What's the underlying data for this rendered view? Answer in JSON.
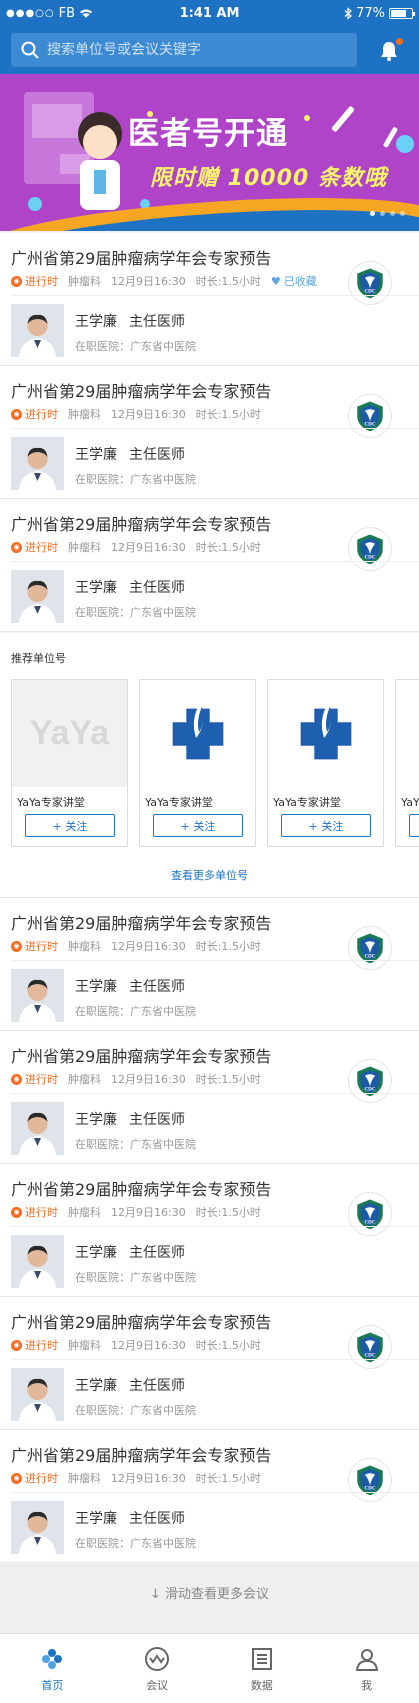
{
  "status_bar": {
    "carrier": "FB",
    "time": "1:41 AM",
    "battery": "77%",
    "battery_level": 0.77
  },
  "search": {
    "placeholder": "搜索单位号或会议关键字"
  },
  "banner": {
    "title": "医者号开通",
    "subtitle": "限时赠 10000 条数哦",
    "pages": 4,
    "active_page": 0
  },
  "meetings": [
    {
      "title": "广州省第29届肿瘤病学年会专家预告",
      "status": "进行时",
      "department": "肿瘤科",
      "time": "12月9日16:30",
      "duration": "时长:1.5小时",
      "favorite": "已收藏",
      "doctor_name": "王学廉",
      "doctor_title": "主任医师",
      "hospital": "在职医院：广东省中医院",
      "logo": "CDC"
    },
    {
      "title": "广州省第29届肿瘤病学年会专家预告",
      "status": "进行时",
      "department": "肿瘤科",
      "time": "12月9日16:30",
      "duration": "时长:1.5小时",
      "doctor_name": "王学廉",
      "doctor_title": "主任医师",
      "hospital": "在职医院：广东省中医院",
      "logo": "CDC"
    },
    {
      "title": "广州省第29届肿瘤病学年会专家预告",
      "status": "进行时",
      "department": "肿瘤科",
      "time": "12月9日16:30",
      "duration": "时长:1.5小时",
      "doctor_name": "王学廉",
      "doctor_title": "主任医师",
      "hospital": "在职医院：广东省中医院",
      "logo": "CDC"
    },
    {
      "title": "广州省第29届肿瘤病学年会专家预告",
      "status": "进行时",
      "department": "肿瘤科",
      "time": "12月9日16:30",
      "duration": "时长:1.5小时",
      "doctor_name": "王学廉",
      "doctor_title": "主任医师",
      "hospital": "在职医院：广东省中医院",
      "logo": "CDC"
    },
    {
      "title": "广州省第29届肿瘤病学年会专家预告",
      "status": "进行时",
      "department": "肿瘤科",
      "time": "12月9日16:30",
      "duration": "时长:1.5小时",
      "doctor_name": "王学廉",
      "doctor_title": "主任医师",
      "hospital": "在职医院：广东省中医院",
      "logo": "CDC"
    },
    {
      "title": "广州省第29届肿瘤病学年会专家预告",
      "status": "进行时",
      "department": "肿瘤科",
      "time": "12月9日16:30",
      "duration": "时长:1.5小时",
      "doctor_name": "王学廉",
      "doctor_title": "主任医师",
      "hospital": "在职医院：广东省中医院",
      "logo": "CDC"
    },
    {
      "title": "广州省第29届肿瘤病学年会专家预告",
      "status": "进行时",
      "department": "肿瘤科",
      "time": "12月9日16:30",
      "duration": "时长:1.5小时",
      "doctor_name": "王学廉",
      "doctor_title": "主任医师",
      "hospital": "在职医院：广东省中医院",
      "logo": "CDC"
    },
    {
      "title": "广州省第29届肿瘤病学年会专家预告",
      "status": "进行时",
      "department": "肿瘤科",
      "time": "12月9日16:30",
      "duration": "时长:1.5小时",
      "doctor_name": "王学廉",
      "doctor_title": "主任医师",
      "hospital": "在职医院：广东省中医院",
      "logo": "CDC"
    }
  ],
  "recommend": {
    "heading": "推荐单位号",
    "items": [
      {
        "name": "YaYa专家讲堂",
        "follow": "+ 关注",
        "logo": "YaYa"
      },
      {
        "name": "YaYa专家讲堂",
        "follow": "+ 关注",
        "logo": "medical-cross-icon"
      },
      {
        "name": "YaYa专家讲堂",
        "follow": "+ 关注",
        "logo": "medical-cross-icon"
      },
      {
        "name": "YaYa专家讲堂",
        "follow": "+ 关注",
        "logo": "medical-cross-icon"
      }
    ],
    "more": "查看更多单位号"
  },
  "load_more": "↓ 滑动查看更多会议",
  "tabs": [
    {
      "label": "首页",
      "icon": "home-icon",
      "active": true
    },
    {
      "label": "会议",
      "icon": "meeting-icon",
      "active": false
    },
    {
      "label": "数据",
      "icon": "data-icon",
      "active": false
    },
    {
      "label": "我",
      "icon": "profile-icon",
      "active": false
    }
  ],
  "colors": {
    "primary": "#1d72c3",
    "accent": "#f36c21",
    "banner": "#b044c8"
  }
}
